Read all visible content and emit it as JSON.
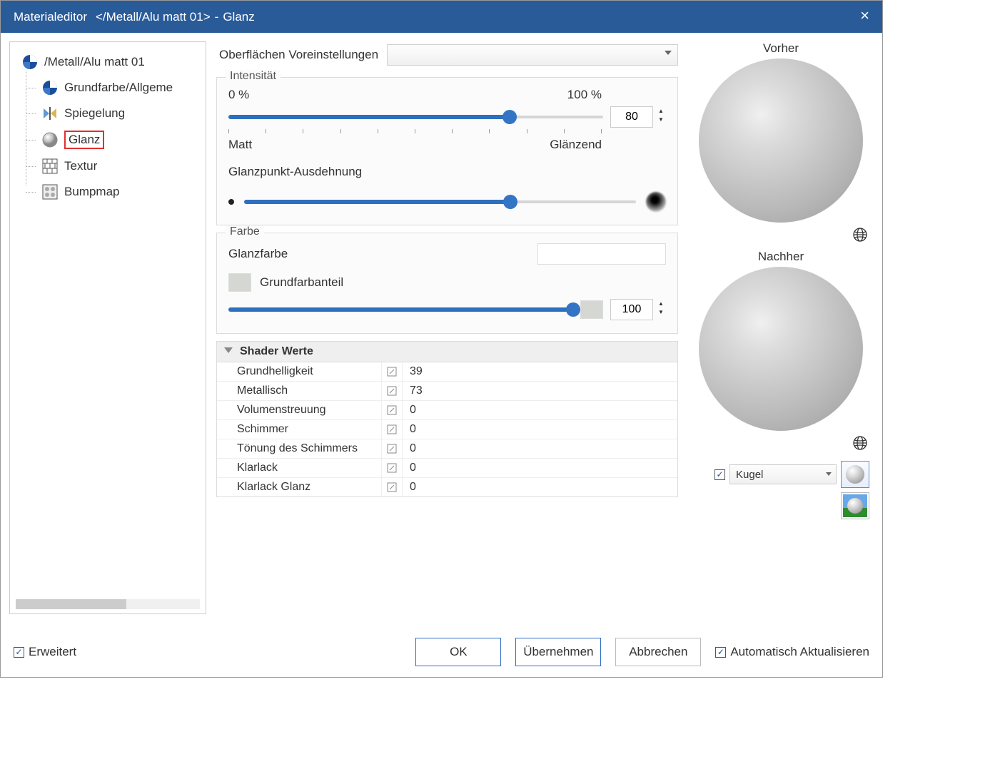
{
  "title": {
    "app": "Materialeditor",
    "path": "</Metall/Alu matt 01>",
    "section": "Glanz"
  },
  "tree": {
    "root": "/Metall/Alu matt 01",
    "items": [
      {
        "key": "grundfarbe",
        "label": "Grundfarbe/Allgeme"
      },
      {
        "key": "spiegelung",
        "label": "Spiegelung"
      },
      {
        "key": "glanz",
        "label": "Glanz"
      },
      {
        "key": "textur",
        "label": "Textur"
      },
      {
        "key": "bumpmap",
        "label": "Bumpmap"
      }
    ]
  },
  "presets": {
    "label": "Oberflächen Voreinstellungen",
    "value": ""
  },
  "intensity": {
    "group": "Intensität",
    "min_label": "0 %",
    "max_label": "100 %",
    "left_label": "Matt",
    "right_label": "Glänzend",
    "value": "80",
    "extent_label": "Glanzpunkt-Ausdehnung"
  },
  "color": {
    "group": "Farbe",
    "glanzfarbe_label": "Glanzfarbe",
    "grundfarbanteil_label": "Grundfarbanteil",
    "grundfarb_swatch": "#d5d7d2",
    "value": "100",
    "mix_swatch": "#d5d7d2"
  },
  "shader": {
    "header": "Shader Werte",
    "rows": [
      {
        "name": "Grundhelligkeit",
        "value": "39"
      },
      {
        "name": "Metallisch",
        "value": "73"
      },
      {
        "name": "Volumenstreuung",
        "value": "0"
      },
      {
        "name": "Schimmer",
        "value": "0"
      },
      {
        "name": "Tönung des Schimmers",
        "value": "0"
      },
      {
        "name": "Klarlack",
        "value": "0"
      },
      {
        "name": "Klarlack Glanz",
        "value": "0"
      }
    ]
  },
  "preview": {
    "before": "Vorher",
    "after": "Nachher",
    "shape": "Kugel"
  },
  "footer": {
    "erweitert": "Erweitert",
    "ok": "OK",
    "apply": "Übernehmen",
    "cancel": "Abbrechen",
    "auto": "Automatisch Aktualisieren"
  }
}
